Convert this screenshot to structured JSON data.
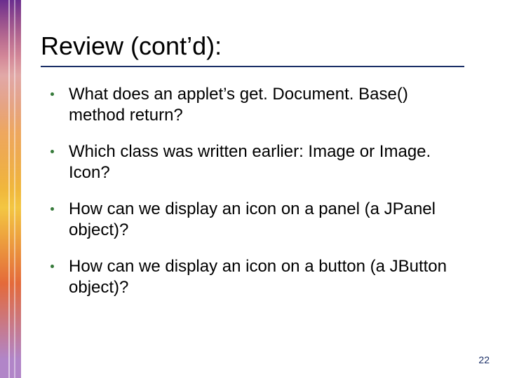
{
  "title": "Review (cont’d):",
  "bullets": [
    "What does an applet’s get. Document. Base() method return?",
    "Which class was written earlier: Image or Image. Icon?",
    "How can we display an icon on a panel (a JPanel object)?",
    "How can we display an icon on a button (a JButton object)?"
  ],
  "page_number": "22"
}
